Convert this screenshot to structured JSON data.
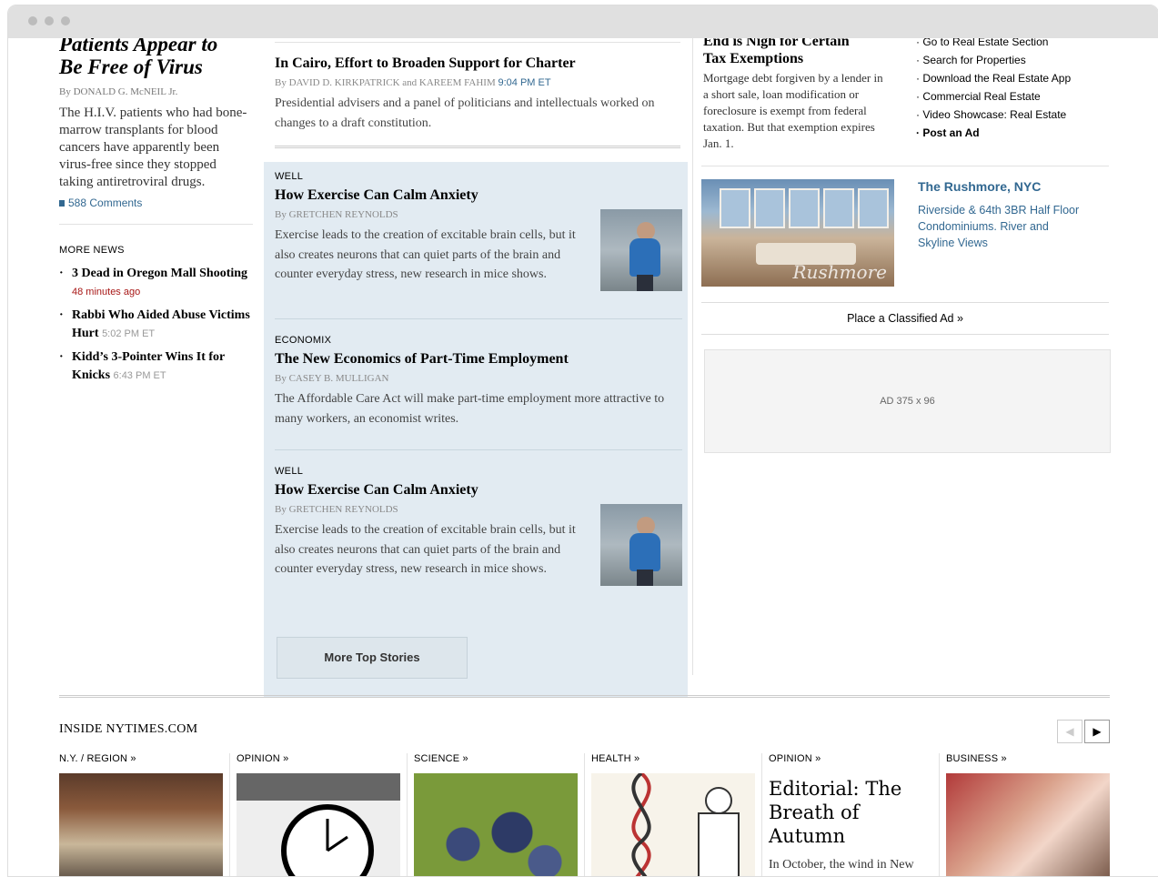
{
  "left": {
    "headline": [
      "Patients Appear to",
      "Be Free of Virus"
    ],
    "byline": "By DONALD G. McNEIL Jr.",
    "summary": "The H.I.V. patients who had bone-marrow transplants for blood cancers have apparently been virus-free since they stopped taking antiretroviral drugs.",
    "comments": "588 Comments",
    "more_news_label": "MORE NEWS",
    "more_news": [
      {
        "title": "3 Dead in Oregon Mall Shooting",
        "time": "48 minutes ago",
        "time_red": true
      },
      {
        "title": "Rabbi Who Aided Abuse Victims Hurt",
        "time": "5:02 PM ET",
        "time_red": false
      },
      {
        "title": "Kidd’s 3-Pointer Wins It for Knicks",
        "time": "6:43 PM ET",
        "time_red": false
      }
    ]
  },
  "middle": {
    "top_story": {
      "headline": "In Cairo, Effort to Broaden Support for Charter",
      "byline_prefix": "By",
      "byline": "DAVID D. KIRKPATRICK and KAREEM FAHIM",
      "time": "9:04 PM ET",
      "summary": "Presidential advisers and a panel of politicians and intellectuals worked on changes to a draft constitution."
    },
    "stories": [
      {
        "kicker": "WELL",
        "headline": "How Exercise Can Calm Anxiety",
        "byline": "GRETCHEN REYNOLDS",
        "summary": "Exercise leads to the creation of excitable brain cells, but it also creates neurons that can quiet parts of the brain and counter everyday stress, new research in mice shows."
      },
      {
        "kicker": "ECONOMIX",
        "headline": "The New Economics of Part-Time Employment",
        "byline": "CASEY B. MULLIGAN",
        "summary": "The Affordable Care Act will make part-time employment more attractive to many workers, an economist writes."
      },
      {
        "kicker": "WELL",
        "headline": "How Exercise Can Calm Anxiety",
        "byline": "GRETCHEN REYNOLDS",
        "summary": "Exercise leads to the creation of excitable brain cells, but it also creates neurons that can quiet parts of the brain and counter everyday stress, new research in mice shows."
      }
    ],
    "more_button": "More Top Stories",
    "byline_prefix": "By"
  },
  "right": {
    "re_headline": [
      "End is Nigh for Certain",
      "Tax Exemptions"
    ],
    "re_summary": "Mortgage debt forgiven by a lender in a short sale, loan modification or foreclosure is exempt from federal taxation. But that exemption expires Jan. 1.",
    "links": [
      "Go to Real Estate Section",
      "Search for Properties",
      "Download the Real Estate App",
      "Commercial Real Estate",
      "Video Showcase: Real Estate",
      "Post an Ad"
    ],
    "listing_title": "The Rushmore, NYC",
    "listing_desc": "Riverside & 64th 3BR Half Floor Condominiums. River and Skyline Views",
    "listing_signature": "Rushmore",
    "classified": "Place a Classified Ad »",
    "ad_label": "AD 375 x 96"
  },
  "inside": {
    "title": "INSIDE NYTIMES.COM",
    "prev_arrow": "◀",
    "next_arrow": "▶",
    "columns": [
      {
        "label": "N.Y. / REGION »"
      },
      {
        "label": "OPINION »"
      },
      {
        "label": "SCIENCE »"
      },
      {
        "label": "HEALTH »"
      },
      {
        "label": "OPINION »",
        "headline": "Editorial: The Breath of Autumn",
        "summary": "In October, the wind in New York is still buoyant, even mocking. It doesn’t numb"
      },
      {
        "label": "BUSINESS »"
      }
    ]
  }
}
